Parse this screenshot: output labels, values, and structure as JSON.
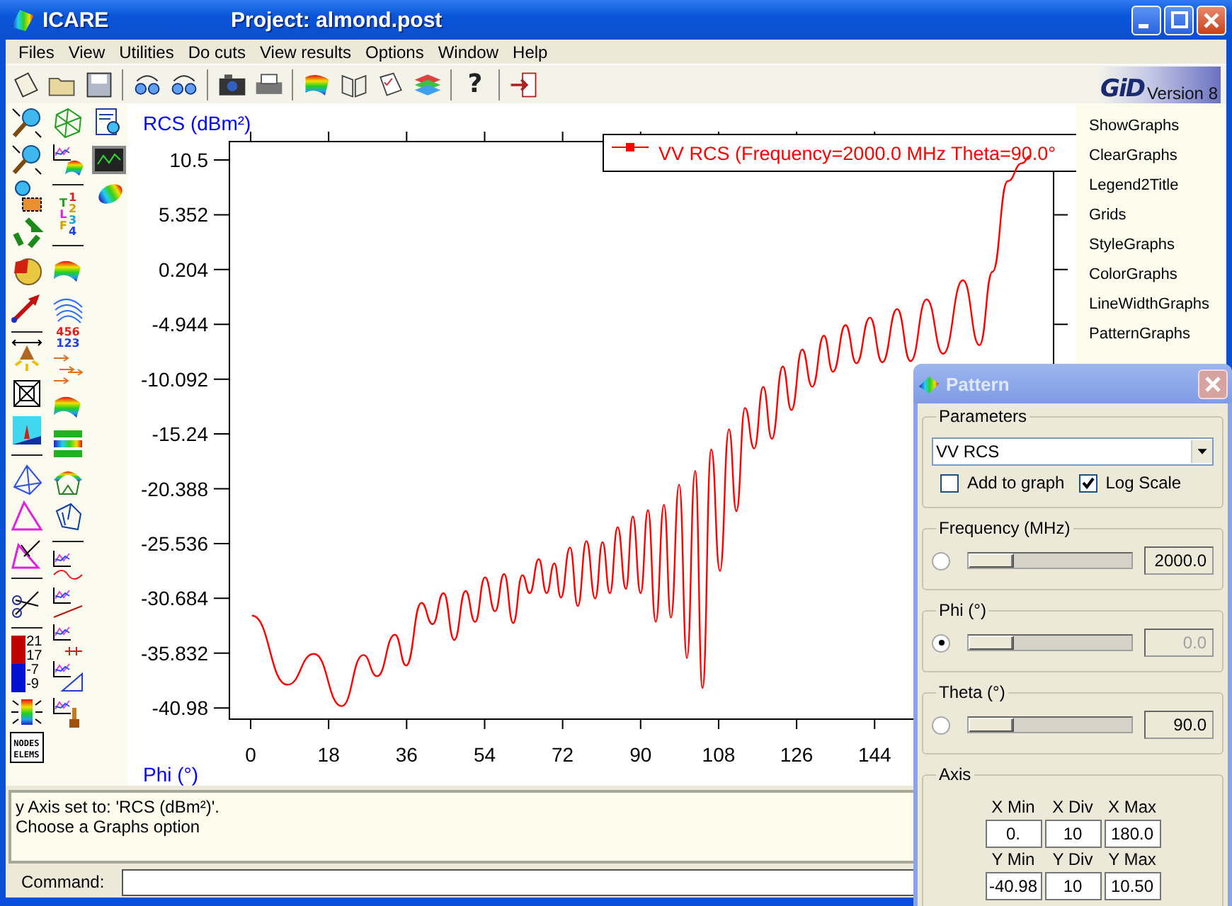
{
  "window": {
    "app_title": "ICARE",
    "project_title": "Project: almond.post"
  },
  "menu": [
    "Files",
    "View",
    "Utilities",
    "Do cuts",
    "View results",
    "Options",
    "Window",
    "Help"
  ],
  "toolbar": {
    "help_glyph": "?"
  },
  "logo": {
    "name": "GiD",
    "version": "Version 8"
  },
  "palette": {
    "layer_letters": [
      "T",
      "L",
      "F"
    ],
    "layer_digits": [
      "1",
      "2",
      "3",
      "4"
    ],
    "numbering_labels": [
      "456",
      "123"
    ],
    "scale_labels": [
      "21",
      "17",
      "-7",
      "-9"
    ],
    "list_labels": [
      "NODES",
      "ELEMS"
    ]
  },
  "chart": {
    "chart_data": {
      "type": "line",
      "xlabel": "Phi (°)",
      "ylabel": "RCS (dBm²)",
      "xlim": [
        -4.9,
        185.3
      ],
      "ylim": [
        -42.03,
        12.23
      ],
      "xticks": [
        0,
        18,
        36,
        54,
        72,
        90,
        108,
        126,
        144
      ],
      "yticks": [
        10.5,
        5.352,
        0.204,
        -4.944,
        -10.092,
        -15.24,
        -20.388,
        -25.536,
        -30.684,
        -35.832,
        -40.98
      ],
      "x": [
        0.3,
        8.5,
        14.6,
        21,
        26,
        29.2,
        33.3,
        35.9,
        39.4,
        42,
        44.5,
        47,
        49.6,
        51.8,
        54.1,
        56.4,
        58.5,
        60.6,
        62.7,
        64.4,
        66.5,
        68.3,
        70.1,
        71.6,
        73.7,
        75.5,
        77.5,
        79.5,
        81.2,
        82.9,
        84.7,
        86.6,
        88.2,
        90,
        91.7,
        93.5,
        95.4,
        97,
        98.9,
        100.7,
        102.6,
        104.3,
        106.3,
        108.3,
        110.4,
        112.1,
        114.1,
        116.2,
        118.3,
        120.3,
        122.8,
        124.8,
        127.3,
        129.6,
        132.3,
        134.4,
        137.3,
        139.8,
        142.9,
        145.8,
        149.2,
        152.3,
        156,
        159.8,
        164.4,
        168.2,
        171.2,
        174.7,
        178,
        180
      ],
      "series": [
        {
          "name": "VV RCS (Frequency=2000.0 MHz Theta=90.0°",
          "color": "#ff0000",
          "values": [
            -32.3,
            -38.8,
            -35.9,
            -40.8,
            -36,
            -38,
            -34.1,
            -37,
            -31.1,
            -33.1,
            -30.2,
            -34.6,
            -30,
            -32.9,
            -28.7,
            -31.9,
            -28.4,
            -33,
            -28.5,
            -30.2,
            -27,
            -30.2,
            -27.4,
            -30.6,
            -25.9,
            -31.4,
            -25.3,
            -30.7,
            -25.4,
            -30.2,
            -24,
            -29.8,
            -23,
            -30.2,
            -22.4,
            -32.9,
            -21.9,
            -32.5,
            -20,
            -36.3,
            -18.7,
            -39.1,
            -16.7,
            -28.1,
            -14.8,
            -22.5,
            -12.8,
            -16.6,
            -10.8,
            -15.7,
            -8.9,
            -13,
            -7.3,
            -10.8,
            -6,
            -9.4,
            -5,
            -8.6,
            -4.3,
            -8.5,
            -3.5,
            -8.4,
            -2.6,
            -7.7,
            -0.8,
            -6.9,
            0,
            8.5,
            10.2,
            10.9
          ]
        }
      ]
    }
  },
  "graph_commands": [
    "ShowGraphs",
    "ClearGraphs",
    "Legend2Title",
    "Grids",
    "StyleGraphs",
    "ColorGraphs",
    "LineWidthGraphs",
    "PatternGraphs"
  ],
  "messages": [
    "y Axis set to: 'RCS (dBm²)'.",
    "Choose a Graphs option"
  ],
  "command": {
    "label": "Command:"
  },
  "pattern_dialog": {
    "title": "Pattern",
    "parameters": {
      "label": "Parameters",
      "quantity": "VV RCS",
      "options": [
        {
          "label": "Add to graph",
          "checked": false
        },
        {
          "label": "Log Scale",
          "checked": true
        }
      ]
    },
    "variables": [
      {
        "label": "Frequency (MHz)",
        "selected": false,
        "level": 0,
        "value": "2000.0",
        "disabled": false
      },
      {
        "label": "Phi (°)",
        "selected": true,
        "level": 0,
        "value": "0.0",
        "disabled": true
      },
      {
        "label": "Theta (°)",
        "selected": false,
        "level": 0,
        "value": "90.0",
        "disabled": false
      }
    ],
    "axis": {
      "label": "Axis",
      "fields": [
        {
          "label": "X Min",
          "value": "0."
        },
        {
          "label": "X Div",
          "value": "10"
        },
        {
          "label": "X Max",
          "value": "180.0"
        },
        {
          "label": "Y Min",
          "value": "-40.98"
        },
        {
          "label": "Y Div",
          "value": "10"
        },
        {
          "label": "Y Max",
          "value": "10.50"
        }
      ]
    }
  }
}
